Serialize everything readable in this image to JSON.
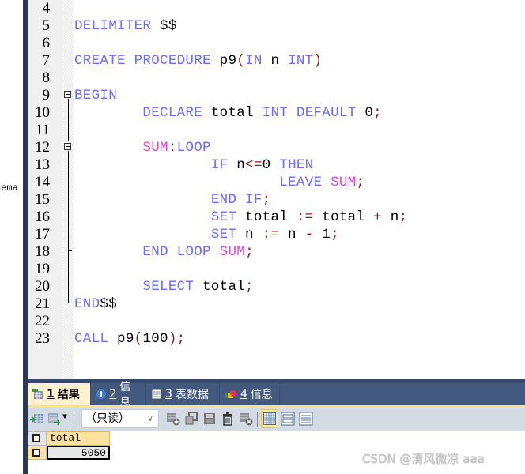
{
  "left_pane": {
    "schema_label": "nema"
  },
  "editor": {
    "lines": [
      {
        "num": "4",
        "tokens": []
      },
      {
        "num": "5",
        "tokens": [
          {
            "t": "DELIMITER",
            "c": "kw"
          },
          {
            "t": " $$",
            "c": ""
          }
        ]
      },
      {
        "num": "6",
        "tokens": []
      },
      {
        "num": "7",
        "tokens": [
          {
            "t": "CREATE",
            "c": "kw"
          },
          {
            "t": " ",
            "c": ""
          },
          {
            "t": "PROCEDURE",
            "c": "kw"
          },
          {
            "t": " p9",
            "c": ""
          },
          {
            "t": "(",
            "c": "op"
          },
          {
            "t": "IN",
            "c": "kw"
          },
          {
            "t": " n ",
            "c": ""
          },
          {
            "t": "INT",
            "c": "kw"
          },
          {
            "t": ")",
            "c": "op"
          }
        ]
      },
      {
        "num": "8",
        "tokens": []
      },
      {
        "num": "9",
        "tokens": [
          {
            "t": "BEGIN",
            "c": "kw"
          }
        ]
      },
      {
        "num": "10",
        "tokens": [
          {
            "t": "\t\t",
            "c": ""
          },
          {
            "t": "DECLARE",
            "c": "kw"
          },
          {
            "t": " total ",
            "c": ""
          },
          {
            "t": "INT",
            "c": "kw"
          },
          {
            "t": " ",
            "c": ""
          },
          {
            "t": "DEFAULT",
            "c": "kw"
          },
          {
            "t": " 0",
            "c": ""
          },
          {
            "t": ";",
            "c": "op"
          }
        ]
      },
      {
        "num": "11",
        "tokens": []
      },
      {
        "num": "12",
        "tokens": [
          {
            "t": "\t\t",
            "c": ""
          },
          {
            "t": "SUM",
            "c": "lbl"
          },
          {
            "t": ":",
            "c": "op"
          },
          {
            "t": "LOOP",
            "c": "kw"
          }
        ]
      },
      {
        "num": "13",
        "tokens": [
          {
            "t": "\t\t\t\t",
            "c": ""
          },
          {
            "t": "IF",
            "c": "kw"
          },
          {
            "t": " n",
            "c": ""
          },
          {
            "t": "<=",
            "c": "op"
          },
          {
            "t": "0 ",
            "c": ""
          },
          {
            "t": "THEN",
            "c": "kw"
          }
        ]
      },
      {
        "num": "14",
        "tokens": [
          {
            "t": "\t\t\t\t\t\t",
            "c": ""
          },
          {
            "t": "LEAVE",
            "c": "kw"
          },
          {
            "t": " ",
            "c": ""
          },
          {
            "t": "SUM",
            "c": "lbl"
          },
          {
            "t": ";",
            "c": "op"
          }
        ]
      },
      {
        "num": "15",
        "tokens": [
          {
            "t": "\t\t\t\t",
            "c": ""
          },
          {
            "t": "END",
            "c": "kw"
          },
          {
            "t": " ",
            "c": ""
          },
          {
            "t": "IF",
            "c": "kw"
          },
          {
            "t": ";",
            "c": "op"
          }
        ]
      },
      {
        "num": "16",
        "tokens": [
          {
            "t": "\t\t\t\t",
            "c": ""
          },
          {
            "t": "SET",
            "c": "kw"
          },
          {
            "t": " total ",
            "c": ""
          },
          {
            "t": ":=",
            "c": "op"
          },
          {
            "t": " total ",
            "c": ""
          },
          {
            "t": "+",
            "c": "op"
          },
          {
            "t": " n",
            "c": ""
          },
          {
            "t": ";",
            "c": "op"
          }
        ]
      },
      {
        "num": "17",
        "tokens": [
          {
            "t": "\t\t\t\t",
            "c": ""
          },
          {
            "t": "SET",
            "c": "kw"
          },
          {
            "t": " n ",
            "c": ""
          },
          {
            "t": ":=",
            "c": "op"
          },
          {
            "t": " n ",
            "c": ""
          },
          {
            "t": "-",
            "c": "op"
          },
          {
            "t": " 1",
            "c": ""
          },
          {
            "t": ";",
            "c": "op"
          }
        ]
      },
      {
        "num": "18",
        "tokens": [
          {
            "t": "\t\t",
            "c": ""
          },
          {
            "t": "END",
            "c": "kw"
          },
          {
            "t": " ",
            "c": ""
          },
          {
            "t": "LOOP",
            "c": "kw"
          },
          {
            "t": " ",
            "c": ""
          },
          {
            "t": "SUM",
            "c": "lbl"
          },
          {
            "t": ";",
            "c": "op"
          }
        ]
      },
      {
        "num": "19",
        "tokens": []
      },
      {
        "num": "20",
        "tokens": [
          {
            "t": "\t\t",
            "c": ""
          },
          {
            "t": "SELECT",
            "c": "kw"
          },
          {
            "t": " total",
            "c": ""
          },
          {
            "t": ";",
            "c": "op"
          }
        ]
      },
      {
        "num": "21",
        "tokens": [
          {
            "t": "END",
            "c": "kw"
          },
          {
            "t": "$$",
            "c": ""
          }
        ]
      },
      {
        "num": "22",
        "tokens": []
      },
      {
        "num": "23",
        "tokens": [
          {
            "t": "CALL",
            "c": "kw"
          },
          {
            "t": " p9",
            "c": ""
          },
          {
            "t": "(",
            "c": "op"
          },
          {
            "t": "100",
            "c": ""
          },
          {
            "t": ")",
            "c": "op"
          },
          {
            "t": ";",
            "c": "op"
          }
        ]
      }
    ]
  },
  "result_tabs": [
    {
      "num": "1",
      "label": "结果",
      "icon": "result-grid-icon",
      "active": true
    },
    {
      "num": "2",
      "label": "信息",
      "icon": "info-icon",
      "active": false
    },
    {
      "num": "3",
      "label": "表数据",
      "icon": "table-data-icon",
      "active": false
    },
    {
      "num": "4",
      "label": "信息",
      "icon": "info-shapes-icon",
      "active": false
    }
  ],
  "toolbar": {
    "mode_select_value": "（只读）",
    "icons": [
      "export-grid-icon",
      "import-grid-icon",
      "add-row-icon",
      "copy-row-icon",
      "save-icon",
      "delete-icon",
      "cancel-icon",
      "grid-view-icon",
      "form-view-icon",
      "text-view-icon"
    ]
  },
  "result_grid": {
    "columns": [
      "total"
    ],
    "rows": [
      [
        "5050"
      ]
    ]
  },
  "watermark": "CSDN @清风微凉 aaa",
  "colors": {
    "keyword": "#6b6bff",
    "label": "#e044d8",
    "operator": "#8b1a1a",
    "tabbar": "#435a7e",
    "active_tab": "#fff1cf",
    "toolbar": "#d5dbe5"
  }
}
